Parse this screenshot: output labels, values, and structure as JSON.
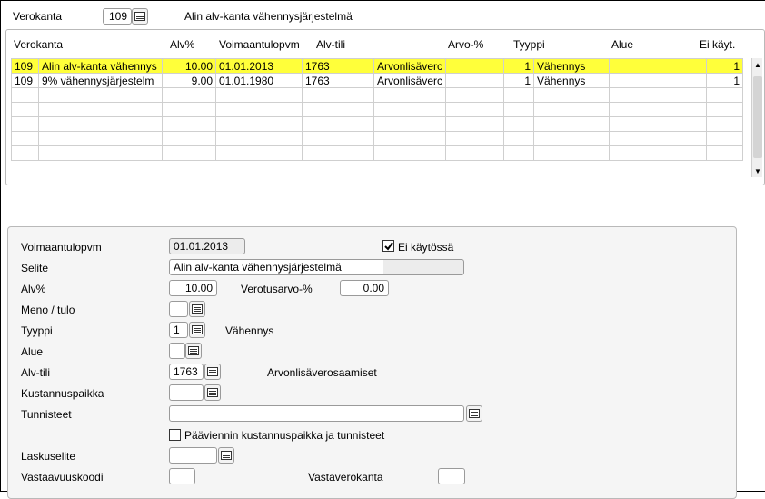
{
  "top": {
    "verokanta_label": "Verokanta",
    "verokanta_value": "109",
    "verokanta_name": "Alin alv-kanta vähennysjärjestelmä"
  },
  "grid": {
    "columns": [
      "Verokanta",
      "Alv%",
      "Voimaantulopvm",
      "Alv-tili",
      "Arvo-%",
      "Tyyppi",
      "Alue",
      "Ei käyt."
    ],
    "rows": [
      {
        "verokanta": "109",
        "nimi": "Alin alv-kanta vähennys",
        "alv": "10.00",
        "pvm": "01.01.2013",
        "tili": "1763",
        "tilinimi": "Arvonlisäverc",
        "arvo": "",
        "tyyppi_nro": "1",
        "tyyppi": "Vähennys",
        "alue": "",
        "ei_kayt": "1"
      },
      {
        "verokanta": "109",
        "nimi": "9% vähennysjärjestelm",
        "alv": "9.00",
        "pvm": "01.01.1980",
        "tili": "1763",
        "tilinimi": "Arvonlisäverc",
        "arvo": "",
        "tyyppi_nro": "1",
        "tyyppi": "Vähennys",
        "alue": "",
        "ei_kayt": "1"
      }
    ],
    "selected_row": 0
  },
  "form": {
    "voimaantulopvm_label": "Voimaantulopvm",
    "voimaantulopvm_value": "01.01.2013",
    "ei_kaytossa_label": "Ei käytössä",
    "ei_kaytossa_checked": true,
    "selite_label": "Selite",
    "selite_value": "Alin alv-kanta vähennysjärjestelmä",
    "alv_label": "Alv%",
    "alv_value": "10.00",
    "verotusarvo_label": "Verotusarvo-%",
    "verotusarvo_value": "0.00",
    "meno_tulo_label": "Meno / tulo",
    "meno_tulo_value": "",
    "tyyppi_label": "Tyyppi",
    "tyyppi_value": "1",
    "tyyppi_name": "Vähennys",
    "alue_label": "Alue",
    "alue_value": "",
    "alv_tili_label": "Alv-tili",
    "alv_tili_value": "1763",
    "alv_tili_name": "Arvonlisäverosaamiset",
    "kustannuspaikka_label": "Kustannuspaikka",
    "kustannuspaikka_value": "",
    "tunnisteet_label": "Tunnisteet",
    "tunnisteet_value": "",
    "paaviennin_label": "Pääviennin kustannuspaikka ja tunnisteet",
    "paaviennin_checked": false,
    "laskuselite_label": "Laskuselite",
    "laskuselite_value": "",
    "vastaavuuskoodi_label": "Vastaavuuskoodi",
    "vastaavuuskoodi_value": "",
    "vastaverokanta_label": "Vastaverokanta",
    "vastaverokanta_value": ""
  }
}
